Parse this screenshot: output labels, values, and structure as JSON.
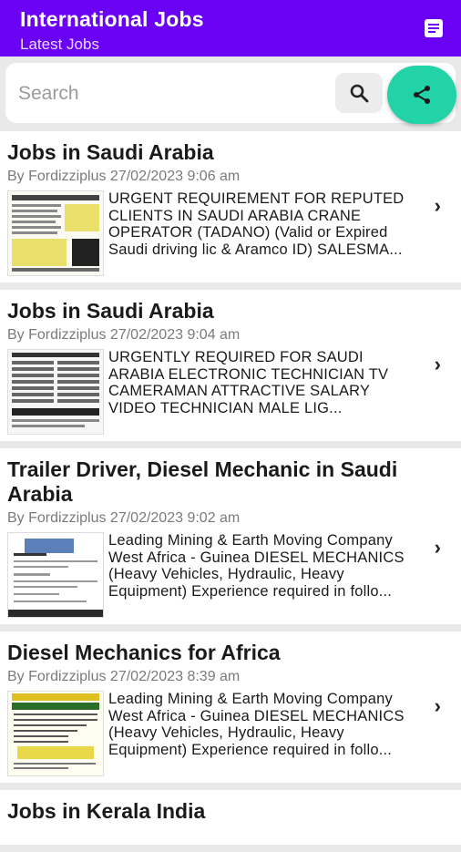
{
  "appbar": {
    "title": "International Jobs",
    "subtitle": "Latest Jobs"
  },
  "search": {
    "placeholder": "Search"
  },
  "posts": [
    {
      "title": "Jobs in Saudi Arabia",
      "meta": "By Fordizziplus 27/02/2023 9:06 am",
      "excerpt": "URGENT REQUIREMENT FOR REPUTED CLIENTS IN SAUDI ARABIA CRANE OPERATOR (TADANO) (Valid or Expired Saudi driving lic & Aramco ID) SALESMA..."
    },
    {
      "title": "Jobs in Saudi Arabia",
      "meta": "By Fordizziplus 27/02/2023 9:04 am",
      "excerpt": "URGENTLY REQUIRED FOR SAUDI ARABIA ELECTRONIC TECHNICIAN TV CAMERAMAN ATTRACTIVE SALARY VIDEO TECHNICIAN MALE LIG..."
    },
    {
      "title": "Trailer Driver, Diesel Mechanic in Saudi Arabia",
      "meta": "By Fordizziplus 27/02/2023 9:02 am",
      "excerpt": "Leading Mining & Earth Moving Company West Africa - Guinea DIESEL MECHANICS (Heavy Vehicles, Hydraulic, Heavy Equipment) Experience required in follo..."
    },
    {
      "title": "Diesel Mechanics for Africa",
      "meta": "By Fordizziplus 27/02/2023 8:39 am",
      "excerpt": "Leading Mining & Earth Moving Company West Africa - Guinea DIESEL MECHANICS (Heavy Vehicles, Hydraulic, Heavy Equipment) Experience required in follo..."
    },
    {
      "title": "Jobs in Kerala India",
      "meta": "",
      "excerpt": ""
    }
  ],
  "colors": {
    "appbar": "#6a00f4",
    "fab": "#22d3a8"
  },
  "icons": {
    "menu": "article-icon",
    "search": "search-icon",
    "share": "share-icon",
    "chevron": "chevron-right-icon"
  }
}
